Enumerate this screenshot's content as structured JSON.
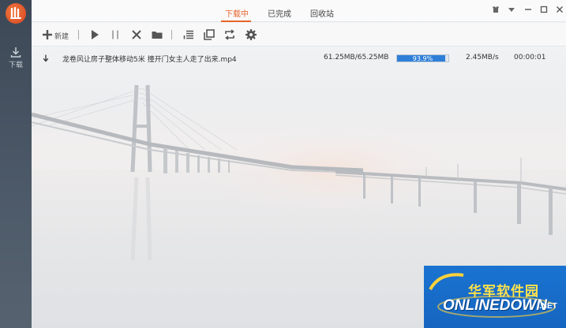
{
  "sidebar": {
    "logo_icon": "app-logo-icon",
    "download_label": "下载"
  },
  "tabs": [
    {
      "label": "下载中",
      "active": true
    },
    {
      "label": "已完成",
      "active": false
    },
    {
      "label": "回收站",
      "active": false
    }
  ],
  "window_controls": [
    "skin-icon",
    "menu-icon",
    "minimize-icon",
    "maximize-icon",
    "close-icon"
  ],
  "toolbar": {
    "new_label": "新建",
    "icons": [
      "add-icon",
      "play-icon",
      "pause-icon",
      "delete-icon",
      "folder-icon",
      "list-icon",
      "copy-icon",
      "repeat-icon",
      "settings-icon"
    ]
  },
  "task": {
    "arrow_icon": "download-arrow-icon",
    "filename": "龙卷风让房子整体移动5米  撞开门女主人走了出来.mp4",
    "size": "61.25MB/65.25MB",
    "progress_text": "93.9%",
    "progress_value": 0.939,
    "speed": "2.45MB/s",
    "time": "00:00:01"
  },
  "watermark": {
    "cn": "华军软件园",
    "en": "ONLINEDOWN",
    "net": ".NET"
  },
  "colors": {
    "accent": "#e8652a",
    "progress": "#2f7fd8",
    "sidebar": "#434f5d"
  }
}
